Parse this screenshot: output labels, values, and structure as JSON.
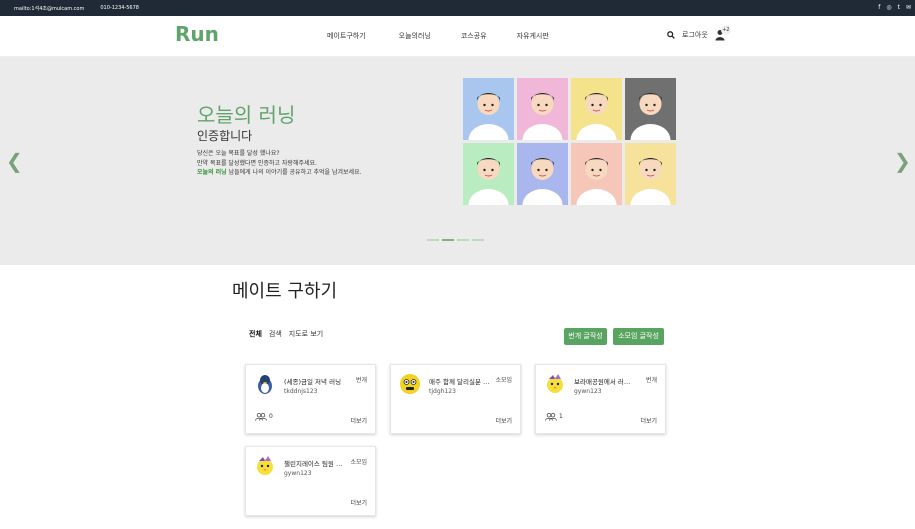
{
  "topbar": {
    "email": "mailto:1석4조@mulcam.com",
    "phone": "010-1234-5678",
    "social": [
      "f",
      "◎",
      "t",
      "✉"
    ]
  },
  "header": {
    "logo": "Run",
    "nav": [
      "메이트구하기",
      "오늘의러닝",
      "코스공유",
      "자유게시판"
    ],
    "logout": "로그아웃",
    "badge": "+2"
  },
  "hero": {
    "title": "오늘의 러닝",
    "subtitle": "인증합니다",
    "line1": "당신은 오늘 목표를 달성 했나요?",
    "line2": "만약 목표를 달성했다면 인증하고 자랑해주세요.",
    "line3_hl": "오늘의 러닝",
    "line3_rest": " 남들에게 나의 이야기를 공유하고 추억을 남겨보세요.",
    "arrow_left": "❮",
    "arrow_right": "❯",
    "slides": 4,
    "active_slide": 2,
    "avatar_colors": [
      "#a9c6ee",
      "#f1b7d8",
      "#f4e38a",
      "#707070",
      "#b9ecc0",
      "#a9b7ee",
      "#f6c6b9",
      "#f6e29a"
    ]
  },
  "mate": {
    "title": "메이트 구하기",
    "tabs": [
      "전체",
      "검색",
      "지도로 보기"
    ],
    "btn_lightning": "번개 글작성",
    "btn_small": "소모임 글작성",
    "more_label": "더보기",
    "cards": [
      {
        "title": "(세종)금일 저녁 러닝",
        "type": "번개",
        "user": "tkddnjs123",
        "count": "0",
        "icon": "penguin-avatar-icon"
      },
      {
        "title": "매주 함께 달리실분 구합니다",
        "type": "소모임",
        "user": "tjdgh123",
        "count": "",
        "icon": "mascot-avatar-icon"
      },
      {
        "title": "보라매공원에서 러닝하실분",
        "type": "번개",
        "user": "gywn123",
        "count": "1",
        "icon": "chick-avatar-icon"
      },
      {
        "title": "챌린지레이스 팀원 모집",
        "type": "소모임",
        "user": "gywn123",
        "count": "",
        "icon": "chick-avatar-icon"
      }
    ]
  }
}
